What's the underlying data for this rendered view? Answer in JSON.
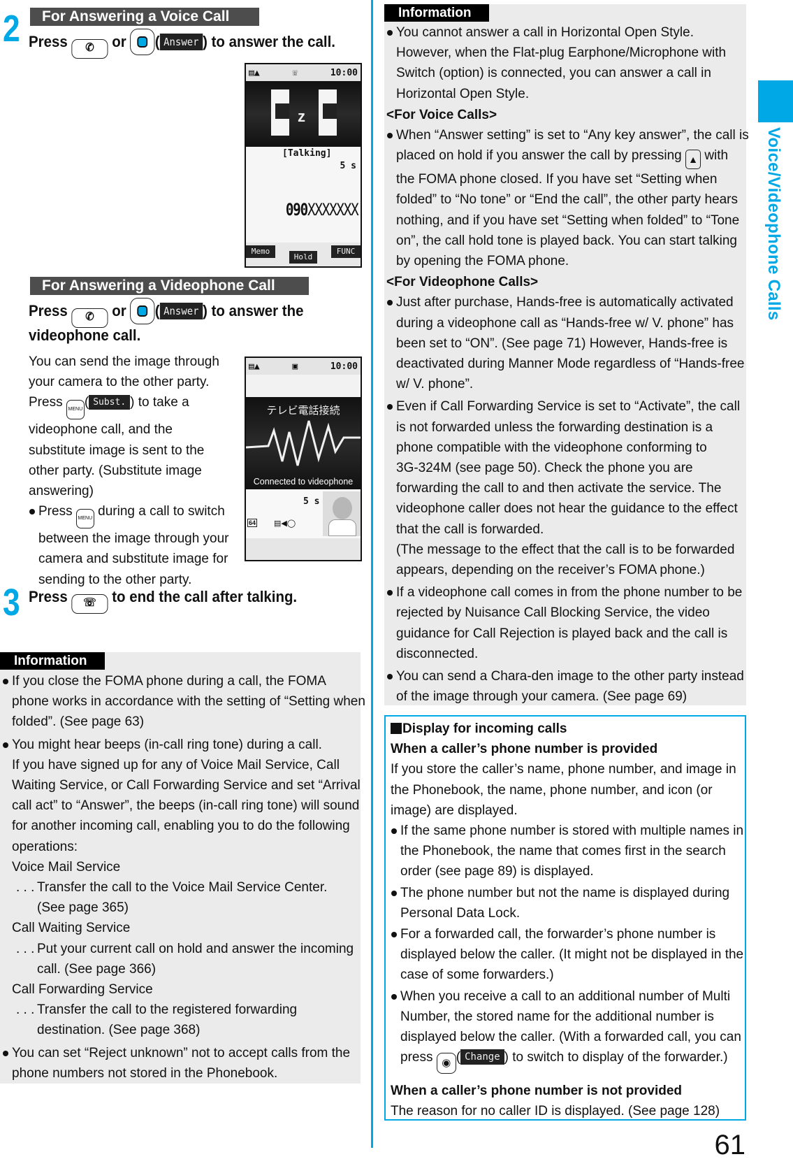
{
  "side_tab": {
    "label": "Voice/Videophone Calls"
  },
  "page_number": "61",
  "step2": {
    "number": "2",
    "voice": {
      "heading": "For Answering a Voice Call",
      "instr_press": "Press",
      "instr_or": "or",
      "softkey": "Answer",
      "instr_tail": ") to answer the call.",
      "screen": {
        "clock": "10:00",
        "status_label": "[Talking]",
        "duration": "5 s",
        "number": "090XXXXXXX",
        "number_bold": "090",
        "number_rest": "XXXXXXX",
        "soft_left": "Memo",
        "soft_center": "Hold",
        "soft_right": "FUNC"
      }
    },
    "video": {
      "heading": "For Answering a Videophone Call",
      "instr_press": "Press",
      "instr_or": "or",
      "softkey": "Answer",
      "instr_tail": ") to answer the",
      "instr_line2": "videophone call.",
      "desc_lines": [
        "You can send the image through",
        "your camera to the other party."
      ],
      "desc_press": "Press",
      "menu_key": "MENU",
      "subst_label": "Subst.",
      "desc_press_tail": ") to take a",
      "desc_lines2": [
        "videophone call, and the",
        "substitute image is sent to the",
        "other party. (Substitute image",
        "answering)"
      ],
      "bullet_press": "Press",
      "bullet_tail": "during a call to switch",
      "bullet_lines": [
        "between the image through your",
        "camera and substitute image for",
        "sending to the other party."
      ],
      "screen": {
        "clock": "10:00",
        "jp_title": "テレビ電話接続",
        "connected": "Connected to videophone",
        "duration": "5 s",
        "rate": "64"
      }
    }
  },
  "step3": {
    "number": "3",
    "instr_press": "Press",
    "instr_tail": "to end the call after talking."
  },
  "info_left": {
    "tag": "Information",
    "items": [
      {
        "lines": [
          "If you close the FOMA phone during a call, the FOMA",
          "phone works in accordance with the setting of “Setting when",
          "folded”. (See page 63)"
        ]
      },
      {
        "lines": [
          "You might hear beeps (in-call ring tone) during a call.",
          "If you have signed up for any of Voice Mail Service, Call",
          "Waiting Service, or Call Forwarding Service and set “Arrival",
          "call act” to “Answer”, the beeps (in-call ring tone) will sound",
          "for another incoming call, enabling you to do the following",
          "operations:"
        ]
      }
    ],
    "services": [
      {
        "name": "Voice Mail Service",
        "desc": [
          "Transfer the call to the Voice Mail Service Center.",
          "(See page 365)"
        ]
      },
      {
        "name": "Call Waiting Service",
        "desc": [
          "Put your current call on hold and answer the incoming",
          "call. (See page 366)"
        ]
      },
      {
        "name": "Call Forwarding Service",
        "desc": [
          "Transfer the call to the registered forwarding",
          "destination. (See page 368)"
        ]
      }
    ],
    "last_item": [
      "You can set “Reject unknown” not to accept calls from the",
      "phone numbers not stored in the Phonebook."
    ],
    "ellipsis": ". . ."
  },
  "info_right": {
    "tag": "Information",
    "item1": [
      "You cannot answer a call in Horizontal Open Style.",
      "However, when the Flat-plug Earphone/Microphone with",
      "Switch (option) is connected, you can answer a call in",
      "Horizontal Open Style."
    ],
    "voice_head": "<For Voice Calls>",
    "voice_item": {
      "l1": "When “Answer setting” is set to “Any key answer”, the call is",
      "l2a": "placed on hold if you answer the call by pressing",
      "l2b": "with",
      "rest": [
        "the FOMA phone closed. If you have set “Setting when",
        "folded” to “No tone” or “End the call”, the other party hears",
        "nothing, and if you have set “Setting when folded” to “Tone",
        "on”, the call hold tone is played back. You can start talking",
        "by opening the FOMA phone."
      ]
    },
    "video_head": "<For Videophone Calls>",
    "video_items": [
      [
        "Just after purchase, Hands-free is automatically activated",
        "during a videophone call as “Hands-free w/ V. phone” has",
        "been set to “ON”. (See page 71) However, Hands-free is",
        "deactivated during Manner Mode regardless of “Hands-free",
        "w/ V. phone”."
      ],
      [
        "Even if Call Forwarding Service is set to “Activate”, the call",
        "is not forwarded unless the forwarding destination is a",
        "phone compatible with the videophone conforming to",
        "3G-324M (see page 50). Check the phone you are",
        "forwarding the call to and then activate the service. The",
        "videophone caller does not hear the guidance to the effect",
        "that the call is forwarded.",
        "(The message to the effect that the call is to be forwarded",
        "appears, depending on the receiver’s FOMA phone.)"
      ],
      [
        "If a videophone call comes in from the phone number to be",
        "rejected by Nuisance Call Blocking Service, the video",
        "guidance for Call Rejection is played back and the call is",
        "disconnected."
      ],
      [
        "You can send a Chara-den image to the other party instead",
        "of the image through your camera. (See page 69)"
      ]
    ]
  },
  "display_box": {
    "title": "Display for incoming calls",
    "sub1": "When a caller’s phone number is provided",
    "para1": [
      "If you store the caller’s name, phone number, and image in",
      "the Phonebook, the name, phone number, and icon (or",
      "image) are displayed."
    ],
    "bullets": [
      [
        "If the same phone number is stored with multiple names in",
        "the Phonebook, the name that comes first in the search",
        "order (see page 89) is displayed."
      ],
      [
        "The phone number but not the name is displayed during",
        "Personal Data Lock."
      ],
      [
        "For a forwarded call, the forwarder’s phone number is",
        "displayed below the caller. (It might not be displayed in the",
        "case of some forwarders.)"
      ],
      [
        "When you receive a call to an additional number of Multi",
        "Number, the stored name for the additional number is",
        "displayed below the caller. (With a forwarded call, you can"
      ]
    ],
    "last_press": "press",
    "change_label": "Change",
    "last_tail": ") to switch to display of the forwarder.)",
    "sub2": "When a caller’s phone number is not provided",
    "para2": "The reason for no caller ID is displayed. (See page 128)"
  }
}
